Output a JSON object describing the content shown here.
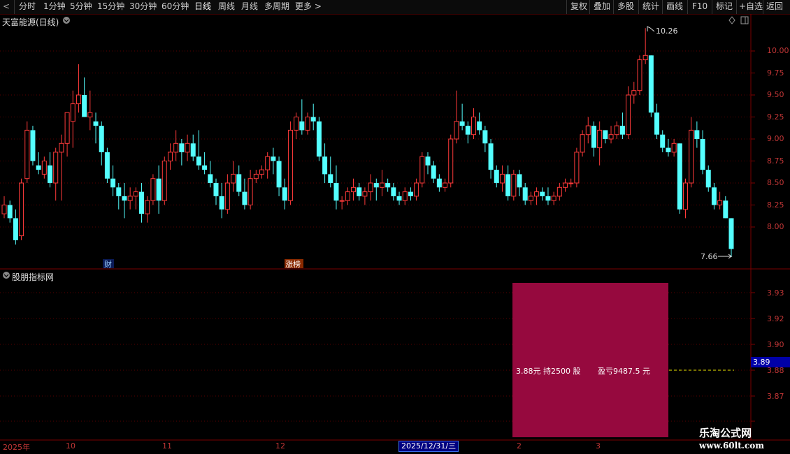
{
  "toolbar": {
    "periods": [
      "分时",
      "1分钟",
      "5分钟",
      "15分钟",
      "30分钟",
      "60分钟",
      "日线",
      "周线",
      "月线",
      "多周期"
    ],
    "active_period": "日线",
    "more": "更多",
    "right_buttons": [
      "复权",
      "叠加",
      "多股",
      "统计",
      "画线",
      "F10",
      "标记",
      "+自选",
      "返回"
    ]
  },
  "chart": {
    "title": "天富能源(日线)",
    "high_label": "10.26",
    "low_label": "7.66",
    "event_label_1": "财",
    "event_label_2": "涨榜",
    "y_ticks": [
      "10.00",
      "9.75",
      "9.50",
      "9.25",
      "9.00",
      "8.75",
      "8.50",
      "8.25",
      "8.00"
    ]
  },
  "indicator": {
    "title": "股朋指标网",
    "y_ticks": [
      "3.93",
      "3.92",
      "3.90",
      "3.88",
      "3.87"
    ],
    "current_price": "3.89",
    "position_text": "3.88元 持2500 股",
    "pl_text": "盈亏9487.5 元"
  },
  "date_axis": {
    "labels": [
      "2025年",
      "10",
      "11",
      "12",
      "2",
      "3"
    ],
    "cursor_date": "2025/12/31/三"
  },
  "watermark": {
    "line1": "乐淘公式网",
    "line2": "www.60lt.com"
  },
  "colors": {
    "up": "#ff3a3a",
    "down": "#54ffff",
    "pnl_box": "#96093e",
    "grid": "#7a0000"
  },
  "chart_data": {
    "type": "candlestick",
    "ohlc": [
      [
        8.15,
        8.35,
        8.1,
        8.25
      ],
      [
        8.25,
        8.3,
        8.05,
        8.1
      ],
      [
        8.1,
        8.2,
        7.8,
        7.85
      ],
      [
        7.9,
        8.55,
        7.85,
        8.5
      ],
      [
        8.55,
        9.2,
        8.5,
        9.1
      ],
      [
        9.1,
        9.15,
        8.7,
        8.75
      ],
      [
        8.7,
        8.85,
        8.6,
        8.65
      ],
      [
        8.6,
        8.8,
        8.55,
        8.75
      ],
      [
        8.7,
        8.85,
        8.45,
        8.5
      ],
      [
        8.5,
        8.9,
        8.3,
        8.85
      ],
      [
        8.85,
        9.05,
        8.3,
        8.95
      ],
      [
        8.95,
        9.25,
        8.8,
        9.3
      ],
      [
        9.2,
        9.55,
        8.9,
        9.4
      ],
      [
        9.4,
        9.85,
        9.3,
        9.5
      ],
      [
        9.5,
        9.7,
        9.25,
        9.25
      ],
      [
        9.25,
        9.55,
        9.1,
        9.3
      ],
      [
        9.2,
        9.3,
        8.95,
        9.15
      ],
      [
        9.15,
        9.2,
        8.7,
        8.85
      ],
      [
        8.85,
        8.9,
        8.5,
        8.55
      ],
      [
        8.55,
        8.7,
        8.35,
        8.45
      ],
      [
        8.45,
        8.5,
        8.2,
        8.35
      ],
      [
        8.35,
        8.5,
        8.1,
        8.3
      ],
      [
        8.3,
        8.45,
        8.2,
        8.35
      ],
      [
        8.35,
        8.45,
        8.2,
        8.4
      ],
      [
        8.4,
        8.5,
        8.05,
        8.15
      ],
      [
        8.15,
        8.35,
        8.05,
        8.3
      ],
      [
        8.3,
        8.6,
        8.25,
        8.55
      ],
      [
        8.55,
        8.7,
        8.15,
        8.3
      ],
      [
        8.3,
        8.8,
        8.25,
        8.75
      ],
      [
        8.75,
        8.95,
        8.65,
        8.85
      ],
      [
        8.85,
        9.1,
        8.75,
        8.95
      ],
      [
        8.95,
        9.0,
        8.7,
        8.85
      ],
      [
        8.85,
        9.05,
        8.75,
        8.95
      ],
      [
        8.95,
        9.05,
        8.75,
        8.8
      ],
      [
        8.8,
        9.1,
        8.65,
        8.7
      ],
      [
        8.7,
        8.85,
        8.6,
        8.65
      ],
      [
        8.6,
        8.75,
        8.45,
        8.5
      ],
      [
        8.5,
        8.55,
        8.25,
        8.35
      ],
      [
        8.35,
        8.5,
        8.1,
        8.2
      ],
      [
        8.2,
        8.6,
        8.15,
        8.5
      ],
      [
        8.5,
        8.75,
        8.4,
        8.6
      ],
      [
        8.6,
        8.7,
        8.35,
        8.4
      ],
      [
        8.4,
        8.55,
        8.2,
        8.25
      ],
      [
        8.25,
        8.65,
        8.2,
        8.55
      ],
      [
        8.55,
        8.65,
        8.5,
        8.6
      ],
      [
        8.6,
        8.7,
        8.55,
        8.65
      ],
      [
        8.65,
        8.85,
        8.55,
        8.8
      ],
      [
        8.8,
        8.9,
        8.6,
        8.75
      ],
      [
        8.75,
        8.8,
        8.35,
        8.45
      ],
      [
        8.45,
        8.55,
        8.2,
        8.3
      ],
      [
        8.3,
        9.2,
        8.25,
        9.1
      ],
      [
        9.1,
        9.3,
        9.0,
        9.25
      ],
      [
        9.2,
        9.45,
        9.05,
        9.1
      ],
      [
        9.1,
        9.3,
        9.05,
        9.25
      ],
      [
        9.25,
        9.4,
        9.1,
        9.2
      ],
      [
        9.2,
        9.25,
        8.75,
        8.8
      ],
      [
        8.8,
        8.95,
        8.5,
        8.6
      ],
      [
        8.6,
        8.8,
        8.45,
        8.5
      ],
      [
        8.5,
        8.7,
        8.2,
        8.3
      ],
      [
        8.3,
        8.35,
        8.2,
        8.3
      ],
      [
        8.3,
        8.45,
        8.25,
        8.4
      ],
      [
        8.4,
        8.55,
        8.3,
        8.45
      ],
      [
        8.45,
        8.5,
        8.3,
        8.35
      ],
      [
        8.35,
        8.45,
        8.25,
        8.4
      ],
      [
        8.4,
        8.6,
        8.3,
        8.5
      ],
      [
        8.5,
        8.55,
        8.3,
        8.45
      ],
      [
        8.45,
        8.65,
        8.35,
        8.5
      ],
      [
        8.5,
        8.55,
        8.4,
        8.45
      ],
      [
        8.45,
        8.5,
        8.3,
        8.35
      ],
      [
        8.35,
        8.4,
        8.25,
        8.3
      ],
      [
        8.3,
        8.45,
        8.25,
        8.4
      ],
      [
        8.4,
        8.45,
        8.3,
        8.35
      ],
      [
        8.35,
        8.55,
        8.3,
        8.5
      ],
      [
        8.5,
        8.85,
        8.45,
        8.8
      ],
      [
        8.8,
        8.85,
        8.6,
        8.7
      ],
      [
        8.7,
        8.75,
        8.5,
        8.55
      ],
      [
        8.55,
        8.6,
        8.4,
        8.45
      ],
      [
        8.45,
        8.55,
        8.4,
        8.5
      ],
      [
        8.5,
        9.05,
        8.45,
        9.0
      ],
      [
        9.0,
        9.55,
        8.95,
        9.2
      ],
      [
        9.2,
        9.4,
        9.1,
        9.15
      ],
      [
        9.15,
        9.2,
        8.95,
        9.05
      ],
      [
        9.05,
        9.35,
        9.0,
        9.25
      ],
      [
        9.2,
        9.3,
        9.05,
        9.1
      ],
      [
        9.1,
        9.15,
        8.85,
        8.95
      ],
      [
        8.95,
        9.0,
        8.55,
        8.65
      ],
      [
        8.65,
        8.7,
        8.45,
        8.5
      ],
      [
        8.5,
        8.7,
        8.4,
        8.6
      ],
      [
        8.6,
        8.7,
        8.3,
        8.35
      ],
      [
        8.35,
        8.65,
        8.3,
        8.6
      ],
      [
        8.6,
        8.65,
        8.35,
        8.45
      ],
      [
        8.45,
        8.5,
        8.25,
        8.3
      ],
      [
        8.3,
        8.4,
        8.25,
        8.35
      ],
      [
        8.35,
        8.45,
        8.25,
        8.4
      ],
      [
        8.4,
        8.45,
        8.3,
        8.35
      ],
      [
        8.35,
        8.45,
        8.25,
        8.3
      ],
      [
        8.3,
        8.4,
        8.25,
        8.35
      ],
      [
        8.35,
        8.5,
        8.3,
        8.45
      ],
      [
        8.45,
        8.55,
        8.4,
        8.5
      ],
      [
        8.5,
        8.55,
        8.45,
        8.5
      ],
      [
        8.5,
        8.9,
        8.45,
        8.85
      ],
      [
        8.85,
        9.1,
        8.8,
        9.05
      ],
      [
        9.05,
        9.25,
        8.95,
        9.15
      ],
      [
        9.15,
        9.2,
        8.8,
        8.9
      ],
      [
        8.9,
        9.2,
        8.7,
        9.1
      ],
      [
        9.1,
        9.1,
        8.95,
        9.0
      ],
      [
        9.0,
        9.15,
        8.95,
        9.05
      ],
      [
        9.05,
        9.2,
        9.0,
        9.15
      ],
      [
        9.15,
        9.3,
        9.0,
        9.05
      ],
      [
        9.05,
        9.6,
        9.0,
        9.5
      ],
      [
        9.5,
        9.65,
        9.4,
        9.55
      ],
      [
        9.55,
        9.95,
        9.5,
        9.9
      ],
      [
        9.9,
        10.26,
        9.85,
        9.95
      ],
      [
        9.95,
        9.95,
        9.25,
        9.3
      ],
      [
        9.3,
        9.4,
        9.0,
        9.05
      ],
      [
        9.05,
        9.1,
        8.85,
        8.9
      ],
      [
        8.9,
        9.0,
        8.8,
        8.85
      ],
      [
        8.85,
        9.0,
        8.8,
        8.95
      ],
      [
        8.95,
        8.95,
        8.15,
        8.2
      ],
      [
        8.2,
        8.55,
        8.1,
        8.5
      ],
      [
        8.5,
        9.25,
        8.45,
        9.1
      ],
      [
        9.1,
        9.2,
        8.9,
        9.0
      ],
      [
        9.0,
        9.1,
        8.6,
        8.65
      ],
      [
        8.65,
        8.7,
        8.4,
        8.45
      ],
      [
        8.45,
        8.5,
        8.2,
        8.25
      ],
      [
        8.25,
        8.4,
        8.2,
        8.3
      ],
      [
        8.3,
        8.35,
        8.1,
        8.1
      ],
      [
        8.1,
        8.1,
        7.66,
        7.75
      ]
    ],
    "y_ticks": [
      10.0,
      9.75,
      9.5,
      9.25,
      9.0,
      8.75,
      8.5,
      8.25,
      8.0
    ],
    "high": 10.26,
    "low": 7.66
  }
}
